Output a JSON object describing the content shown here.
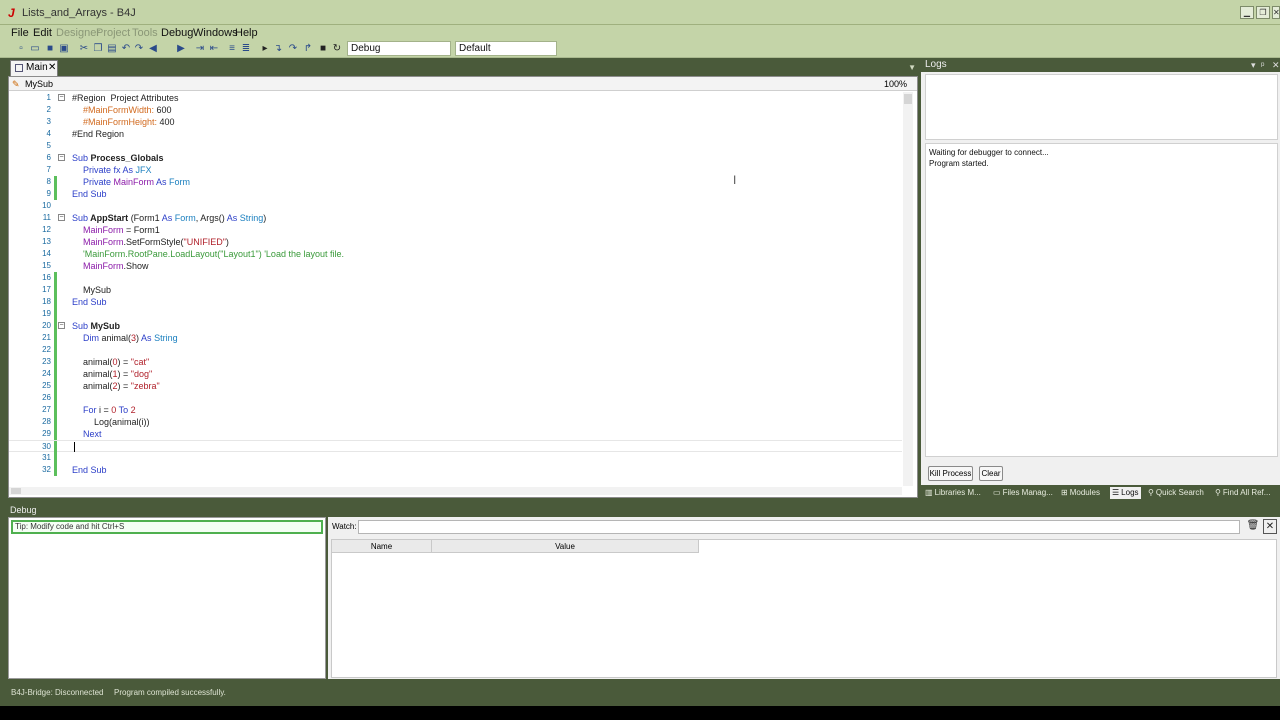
{
  "window": {
    "title": "Lists_and_Arrays - B4J",
    "app_icon": "J",
    "controls": [
      "minimize-icon",
      "maximize-icon",
      "close-icon"
    ]
  },
  "menu": {
    "items": [
      {
        "label": "File",
        "enabled": true
      },
      {
        "label": "Edit",
        "enabled": true
      },
      {
        "label": "Designer",
        "enabled": false
      },
      {
        "label": "Project",
        "enabled": false
      },
      {
        "label": "Tools",
        "enabled": false
      },
      {
        "label": "Debug",
        "enabled": true
      },
      {
        "label": "Windows",
        "enabled": true
      },
      {
        "label": "Help",
        "enabled": true
      }
    ]
  },
  "toolbar": {
    "build_config": "Debug",
    "profile": "Default",
    "icons": [
      "new-icon",
      "open-icon",
      "save-icon",
      "save-all-icon",
      "cut-icon",
      "copy-icon",
      "paste-icon",
      "undo-icon",
      "redo-icon",
      "back-icon",
      "forward-icon",
      "indent-icon",
      "outdent-icon",
      "comment-icon",
      "uncomment-icon",
      "run-icon",
      "step-in-icon",
      "step-over-icon",
      "step-out-icon",
      "stop-icon",
      "restart-icon"
    ]
  },
  "editor": {
    "tab_label": "Main",
    "tab_close": "✕",
    "sub_name": "MySub",
    "zoom": "100%",
    "lines": [
      {
        "n": "1",
        "fold": "⊟",
        "chg": false
      },
      {
        "n": "2",
        "chg": false
      },
      {
        "n": "3",
        "chg": false
      },
      {
        "n": "4",
        "chg": false
      },
      {
        "n": "5",
        "chg": false
      },
      {
        "n": "6",
        "fold": "⊟",
        "chg": false
      },
      {
        "n": "7",
        "chg": false
      },
      {
        "n": "8",
        "chg": true
      },
      {
        "n": "9",
        "chg": true
      },
      {
        "n": "10",
        "chg": false
      },
      {
        "n": "11",
        "fold": "⊟",
        "chg": false
      },
      {
        "n": "12",
        "chg": false
      },
      {
        "n": "13",
        "chg": false
      },
      {
        "n": "14",
        "chg": false
      },
      {
        "n": "15",
        "chg": false
      },
      {
        "n": "16",
        "chg": true
      },
      {
        "n": "17",
        "chg": true
      },
      {
        "n": "18",
        "chg": true
      },
      {
        "n": "19",
        "chg": true
      },
      {
        "n": "20",
        "fold": "⊟",
        "chg": true
      },
      {
        "n": "21",
        "chg": true
      },
      {
        "n": "22",
        "chg": true
      },
      {
        "n": "23",
        "chg": true
      },
      {
        "n": "24",
        "chg": true
      },
      {
        "n": "25",
        "chg": true
      },
      {
        "n": "26",
        "chg": true
      },
      {
        "n": "27",
        "chg": true
      },
      {
        "n": "28",
        "chg": true
      },
      {
        "n": "29",
        "chg": true
      },
      {
        "n": "30",
        "chg": true,
        "current": true
      },
      {
        "n": "31",
        "chg": true
      },
      {
        "n": "32",
        "chg": true
      }
    ],
    "code": {
      "l1": {
        "a": "#Region  Project Attributes"
      },
      "l2": {
        "a": "#MainFormWidth:",
        "b": " 600"
      },
      "l3": {
        "a": "#MainFormHeight:",
        "b": " 400"
      },
      "l4": {
        "a": "#End Region"
      },
      "l6": {
        "a": "Sub",
        "b": " Process_Globals"
      },
      "l7": {
        "a": "Private fx ",
        "b": "As",
        "c": " JFX"
      },
      "l8": {
        "a": "Private ",
        "b": "MainForm",
        "c": " As",
        "d": " Form"
      },
      "l9": {
        "a": "End Sub"
      },
      "l11": {
        "a": "Sub",
        "b": " AppStart",
        "c": " (Form1 ",
        "d": "As",
        "e": " Form",
        "f": ", Args() ",
        "g": "As",
        "h": " String",
        "i": ")"
      },
      "l12": {
        "a": "MainForm",
        "b": " = Form1"
      },
      "l13": {
        "a": "MainForm",
        "b": ".SetFormStyle(",
        "c": "\"UNIFIED\"",
        "d": ")"
      },
      "l14": {
        "a": "'MainForm.RootPane.LoadLayout(\"Layout1\") 'Load the layout file."
      },
      "l15": {
        "a": "MainForm",
        "b": ".Show"
      },
      "l17": {
        "a": "MySub"
      },
      "l18": {
        "a": "End Sub"
      },
      "l20": {
        "a": "Sub",
        "b": " MySub"
      },
      "l21": {
        "a": "Dim",
        "b": " animal(",
        "c": "3",
        "d": ") ",
        "e": "As",
        "f": " String"
      },
      "l23": {
        "a": "animal(",
        "b": "0",
        "c": ") = ",
        "d": "\"cat\""
      },
      "l24": {
        "a": "animal(",
        "b": "1",
        "c": ") = ",
        "d": "\"dog\""
      },
      "l25": {
        "a": "animal(",
        "b": "2",
        "c": ") = ",
        "d": "\"zebra\""
      },
      "l27": {
        "a": "For",
        "b": " i = ",
        "c": "0",
        "d": " To",
        "e": " 2"
      },
      "l28": {
        "a": "Log",
        "b": "(animal(i))"
      },
      "l29": {
        "a": "Next"
      },
      "l32": {
        "a": "End Sub"
      }
    }
  },
  "logs": {
    "title": "Logs",
    "header_controls": [
      "▾",
      "ᵖ",
      "✕"
    ],
    "lines": [
      "Waiting for debugger to connect...",
      "Program started."
    ],
    "kill_label": "Kill Process",
    "clear_label": "Clear"
  },
  "side_tabs": [
    {
      "icon": "📚",
      "label": "Libraries M..."
    },
    {
      "icon": "📁",
      "label": "Files Manag..."
    },
    {
      "icon": "⊞",
      "label": "Modules"
    },
    {
      "icon": "☰",
      "label": "Logs",
      "active": true
    },
    {
      "icon": "🔍",
      "label": "Quick Search"
    },
    {
      "icon": "⚲",
      "label": "Find All Ref..."
    }
  ],
  "debug": {
    "title": "Debug",
    "tip": "Tip: Modify code and hit Ctrl+S",
    "watch_label": "Watch:",
    "col_name": "Name",
    "col_value": "Value"
  },
  "status": {
    "bridge": "B4J-Bridge: Disconnected",
    "message": "Program compiled successfully."
  }
}
